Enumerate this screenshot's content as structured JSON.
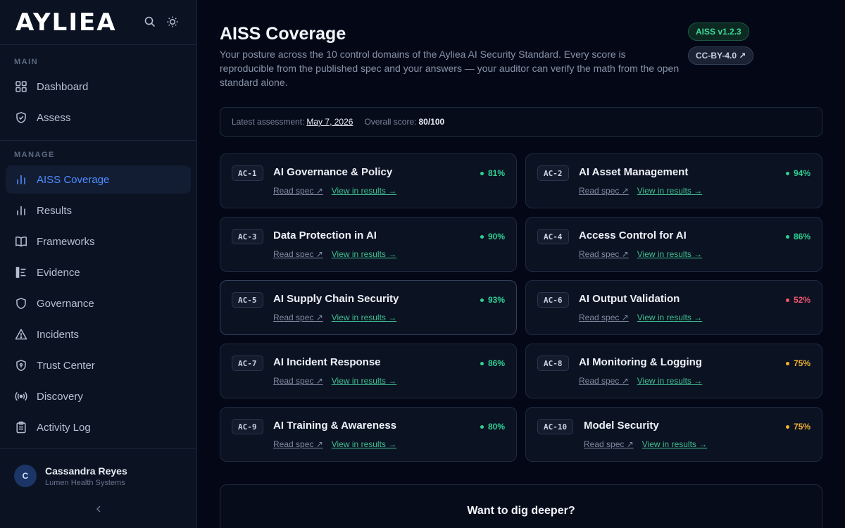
{
  "brand": {
    "name": "AYLIEA"
  },
  "top_icons": [
    "search-icon",
    "sun-icon"
  ],
  "sidebar": {
    "sections": [
      {
        "label": "MAIN",
        "items": [
          {
            "label": "Dashboard",
            "icon": "grid-icon",
            "active": false
          },
          {
            "label": "Assess",
            "icon": "shield-check-icon",
            "active": false
          }
        ]
      },
      {
        "label": "MANAGE",
        "items": [
          {
            "label": "AISS Coverage",
            "icon": "bar-chart-icon",
            "active": true
          },
          {
            "label": "Results",
            "icon": "bar-chart-icon",
            "active": false
          },
          {
            "label": "Frameworks",
            "icon": "book-icon",
            "active": false
          },
          {
            "label": "Evidence",
            "icon": "evidence-icon",
            "active": false
          },
          {
            "label": "Governance",
            "icon": "shield-icon",
            "active": false
          },
          {
            "label": "Incidents",
            "icon": "warning-icon",
            "active": false
          },
          {
            "label": "Trust Center",
            "icon": "shield-lock-icon",
            "active": false
          },
          {
            "label": "Discovery",
            "icon": "broadcast-icon",
            "active": false
          },
          {
            "label": "Activity Log",
            "icon": "clipboard-icon",
            "active": false
          }
        ]
      }
    ]
  },
  "user": {
    "initial": "C",
    "name": "Cassandra Reyes",
    "org": "Lumen Health Systems"
  },
  "page": {
    "title": "AISS Coverage",
    "description": "Your posture across the 10 control domains of the Ayliea AI Security Standard. Every score is reproducible from the published spec and your answers — your auditor can verify the math from the open standard alone.",
    "badges": {
      "version": "AISS v1.2.3",
      "license": "CC-BY-4.0 ↗"
    }
  },
  "summary": {
    "latest_label": "Latest assessment:",
    "latest_value": "May 7, 2026",
    "overall_label": "Overall score:",
    "overall_value": "80/100"
  },
  "controls": [
    {
      "code": "AC-1",
      "title": "AI Governance & Policy",
      "score": "81%",
      "status": "good"
    },
    {
      "code": "AC-2",
      "title": "AI Asset Management",
      "score": "94%",
      "status": "good"
    },
    {
      "code": "AC-3",
      "title": "Data Protection in AI",
      "score": "90%",
      "status": "good"
    },
    {
      "code": "AC-4",
      "title": "Access Control for AI",
      "score": "86%",
      "status": "good"
    },
    {
      "code": "AC-5",
      "title": "AI Supply Chain Security",
      "score": "93%",
      "status": "good"
    },
    {
      "code": "AC-6",
      "title": "AI Output Validation",
      "score": "52%",
      "status": "bad"
    },
    {
      "code": "AC-7",
      "title": "AI Incident Response",
      "score": "86%",
      "status": "good"
    },
    {
      "code": "AC-8",
      "title": "AI Monitoring & Logging",
      "score": "75%",
      "status": "warn"
    },
    {
      "code": "AC-9",
      "title": "AI Training & Awareness",
      "score": "80%",
      "status": "good"
    },
    {
      "code": "AC-10",
      "title": "Model Security",
      "score": "75%",
      "status": "warn"
    }
  ],
  "links": {
    "read_spec": "Read spec ↗",
    "view_results": "View in results →"
  },
  "status_colors": {
    "good": "#2fd193",
    "warn": "#f2b233",
    "bad": "#f0566e"
  },
  "deeper": {
    "title": "Want to dig deeper?"
  }
}
